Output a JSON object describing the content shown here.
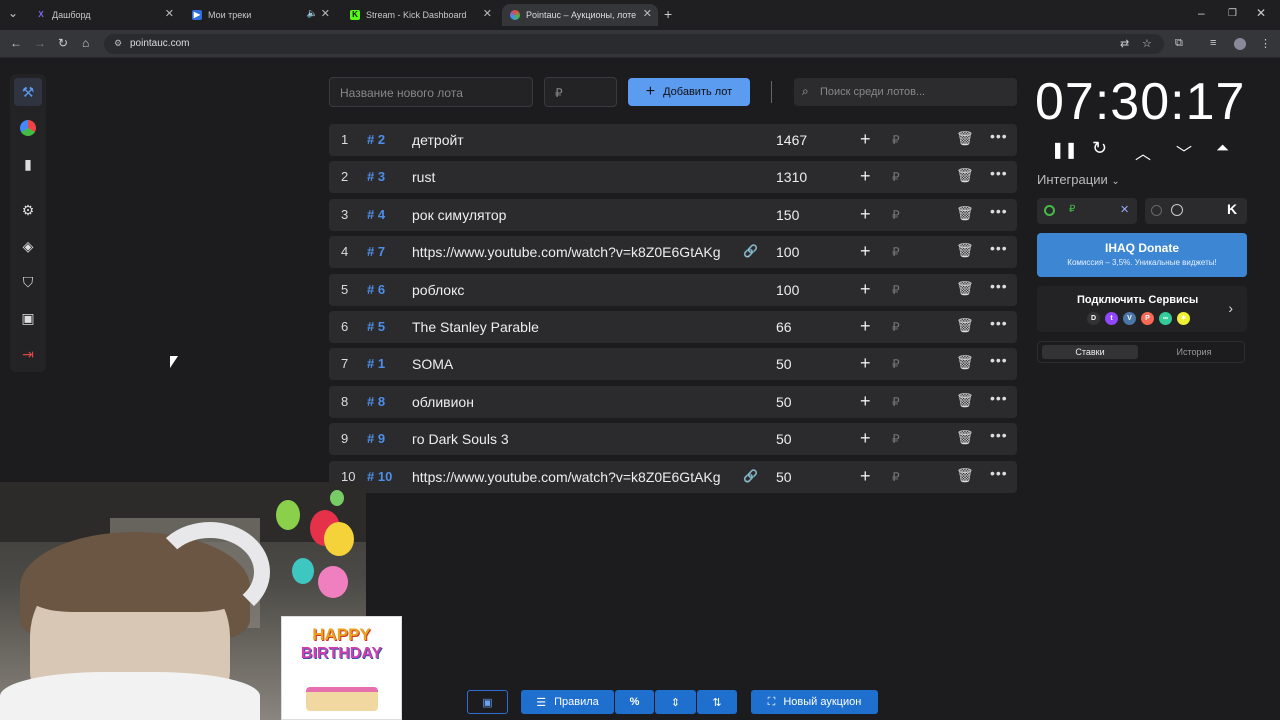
{
  "browser": {
    "tabs": [
      {
        "label": "Дашборд"
      },
      {
        "label": "Мои треки"
      },
      {
        "label": "Stream - Kick Dashboard"
      },
      {
        "label": "Pointauc – Аукционы, лотереи"
      }
    ],
    "url": "pointauc.com"
  },
  "toolbar": {
    "lot_name_placeholder": "Название нового лота",
    "amount_placeholder": "₽",
    "add_lot_label": "Добавить лот",
    "search_placeholder": "Поиск среди лотов..."
  },
  "lots": [
    {
      "num": "1",
      "id": "# 2",
      "name": "детройт",
      "amount": "1467",
      "link": false
    },
    {
      "num": "2",
      "id": "# 3",
      "name": "rust",
      "amount": "1310",
      "link": false
    },
    {
      "num": "3",
      "id": "# 4",
      "name": "рок симулятор",
      "amount": "150",
      "link": false
    },
    {
      "num": "4",
      "id": "# 7",
      "name": "https://www.youtube.com/watch?v=k8Z0E6GtAKg",
      "amount": "100",
      "link": true
    },
    {
      "num": "5",
      "id": "# 6",
      "name": "роблокс",
      "amount": "100",
      "link": false
    },
    {
      "num": "6",
      "id": "# 5",
      "name": "The Stanley Parable",
      "amount": "66",
      "link": false
    },
    {
      "num": "7",
      "id": "# 1",
      "name": "SOMA",
      "amount": "50",
      "link": false
    },
    {
      "num": "8",
      "id": "# 8",
      "name": "обливион",
      "amount": "50",
      "link": false
    },
    {
      "num": "9",
      "id": "# 9",
      "name": "го Dark Souls 3",
      "amount": "50",
      "link": false
    },
    {
      "num": "10",
      "id": "# 10",
      "name": "https://www.youtube.com/watch?v=k8Z0E6GtAKg",
      "amount": "50",
      "link": true
    }
  ],
  "currency_symbol": "₽",
  "timer": "07:30:17",
  "integrations": {
    "label": "Интеграции",
    "donate_title": "IHAQ Donate",
    "donate_sub": "Комиссия – 3,5%. Уникальные виджеты!",
    "connect_label": "Подключить Сервисы",
    "tab_bets": "Ставки",
    "tab_history": "История"
  },
  "overlay": {
    "happy": "HAPPY",
    "birthday": "BIRTHDAY"
  },
  "bottom": {
    "rules_label": "Правила",
    "percent_label": "%",
    "new_auction_label": "Новый аукцион"
  },
  "colors": {
    "accent": "#5b9bf0",
    "lot_id": "#4d8ee8",
    "background": "#1c1c1e",
    "row": "#2b2b2e",
    "button_blue": "#1f6fcf"
  }
}
